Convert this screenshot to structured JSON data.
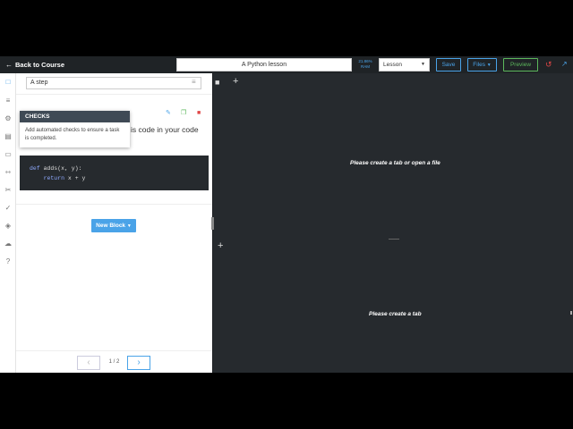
{
  "topbar": {
    "back_label": "Back to Course",
    "lesson_title": "A Python lesson",
    "ram_percent": "21.86%",
    "ram_label": "RAM",
    "mode_select": "Lesson",
    "save_label": "Save",
    "files_label": "Files",
    "preview_label": "Preview"
  },
  "panel": {
    "step_name": "A step",
    "lesson_text_line1": "is code in your code",
    "code_line1_kw": "def",
    "code_line1_rest": " adds(x, y):",
    "code_line2_kw": "    return",
    "code_line2_rest": " x + y",
    "new_block_label": "New Block",
    "page_indicator": "1 / 2"
  },
  "tooltip": {
    "title": "CHECKS",
    "body": "Add automated checks to ensure a task is completed."
  },
  "editor": {
    "top_message": "Please create a tab or open a file",
    "bottom_message": "Please create a tab"
  },
  "colors": {
    "accent": "#4aa3e8",
    "preview": "#5cb85c",
    "danger": "#e04646",
    "dark_bg": "#262a2e"
  }
}
